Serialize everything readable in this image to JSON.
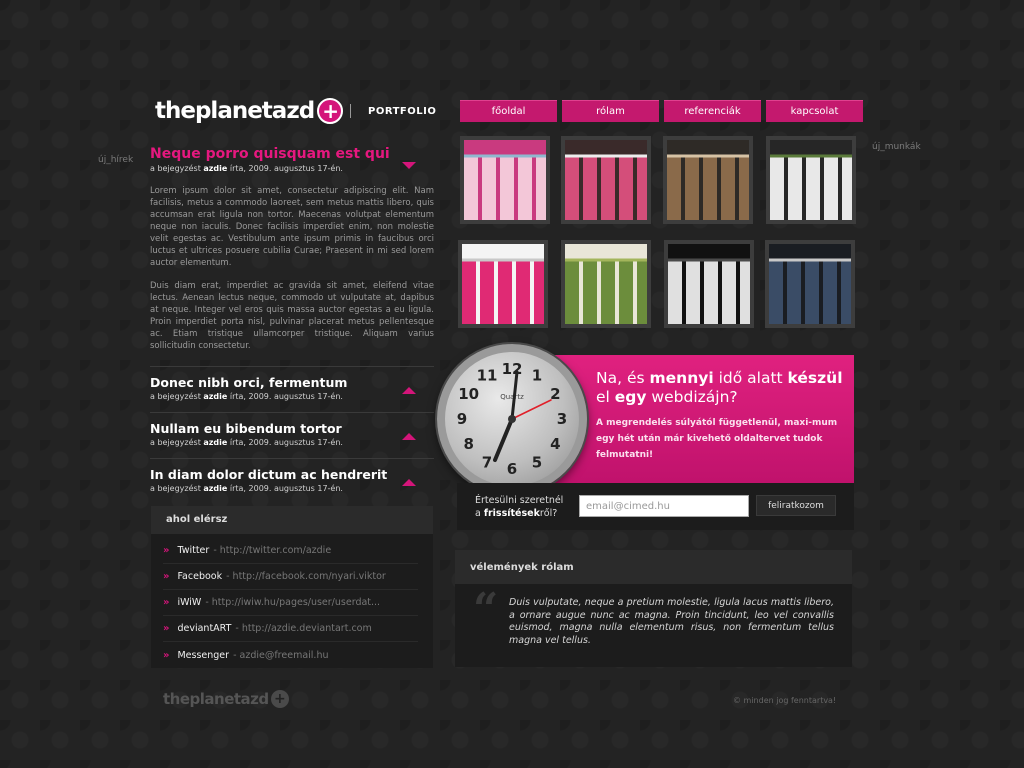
{
  "header": {
    "logo_text": "theplanetazd",
    "logo_plus": "+",
    "section": "PORTFOLIO"
  },
  "nav": [
    "főoldal",
    "rólam",
    "referenciák",
    "kapcsolat"
  ],
  "labels": {
    "news": "új_hírek",
    "works": "új_munkák"
  },
  "news": {
    "open": {
      "title": "Neque porro quisquam est qui",
      "meta_prefix": "a bejegyzést",
      "author": "azdie",
      "meta_suffix": "írta, 2009. augusztus 17-én.",
      "paragraphs": [
        "Lorem ipsum dolor sit amet, consectetur adipiscing elit. Nam facilisis, metus a commodo laoreet, sem metus mattis libero, quis accumsan erat ligula non tortor. Maecenas volutpat elementum neque non iaculis. Donec facilisis imperdiet enim, non molestie velit egestas ac. Vestibulum ante ipsum primis in faucibus orci luctus et ultrices posuere cubilia Curae; Praesent in mi sed lorem auctor elementum.",
        "Duis diam erat, imperdiet ac gravida sit amet, eleifend vitae lectus. Aenean lectus neque, commodo ut vulputate at, dapibus at neque. Integer vel eros quis massa auctor egestas a eu ligula. Proin imperdiet porta nisl, pulvinar placerat metus pellentesque ac. Etiam tristique ullamcorper tristique. Aliquam varius sollicitudin consectetur."
      ]
    },
    "collapsed": [
      {
        "title": "Donec nibh orci, fermentum",
        "meta_prefix": "a bejegyzést",
        "author": "azdie",
        "meta_suffix": "írta, 2009. augusztus 17-én."
      },
      {
        "title": "Nullam eu bibendum tortor",
        "meta_prefix": "a bejegyzést",
        "author": "azdie",
        "meta_suffix": "írta, 2009. augusztus 17-én."
      },
      {
        "title": "In diam dolor dictum ac hendrerit",
        "meta_prefix": "a bejegyzést",
        "author": "azdie",
        "meta_suffix": "írta, 2009. augusztus 17-én."
      }
    ]
  },
  "contact": {
    "title": "ahol elérsz",
    "items": [
      {
        "name": "Twitter",
        "url": "- http://twitter.com/azdie"
      },
      {
        "name": "Facebook",
        "url": "- http://facebook.com/nyari.viktor"
      },
      {
        "name": "iWiW",
        "url": "- http://iwiw.hu/pages/user/userdat..."
      },
      {
        "name": "deviantART",
        "url": "- http://azdie.deviantart.com"
      },
      {
        "name": "Messenger",
        "url": "- azdie@freemail.hu"
      }
    ]
  },
  "thumbnails": [
    {
      "colors": [
        "#c93a7f",
        "#f3c7d8",
        "#8fb9cf"
      ]
    },
    {
      "colors": [
        "#3a2a2a",
        "#d44e7a",
        "#ededed"
      ]
    },
    {
      "colors": [
        "#2e2a26",
        "#8a6a4a",
        "#d7c3a5"
      ]
    },
    {
      "colors": [
        "#262626",
        "#e8e8e8",
        "#5a7a3a"
      ]
    },
    {
      "colors": [
        "#f4f4f4",
        "#e02a74",
        "#c8c8c8"
      ]
    },
    {
      "colors": [
        "#e9e6d8",
        "#6c8d3c",
        "#a3b55b"
      ]
    },
    {
      "colors": [
        "#111111",
        "#e0e0e0",
        "#4a4a4a"
      ]
    },
    {
      "colors": [
        "#1a1d22",
        "#3a4c66",
        "#c8c8c8"
      ]
    }
  ],
  "promo": {
    "line1_a": "Na, és ",
    "line1_b": "mennyi",
    "line1_c": " idő alatt ",
    "line1_d": "készül",
    "line2_a": "el ",
    "line2_b": "egy",
    "line2_c": " webdizájn?",
    "sub": "A megrendelés súlyától függetlenül, maxi-mum egy hét után már kivehető oldaltervet tudok felmutatni!",
    "clock_brand": "Quartz",
    "clock_numbers": [
      "12",
      "1",
      "2",
      "3",
      "4",
      "5",
      "6",
      "7",
      "8",
      "9",
      "10",
      "11"
    ]
  },
  "notify": {
    "line1": "Értesülni szeretnél",
    "line2_a": "a ",
    "line2_b": "frissítések",
    "line2_c": "ről?",
    "placeholder": "email@cimed.hu",
    "button": "feliratkozom"
  },
  "opinions": {
    "title": "vélemények rólam",
    "quote_mark": "“",
    "quote": "Duis vulputate, neque a pretium molestie, ligula lacus mattis libero, a ornare augue nunc ac magna. Proin tincidunt, leo vel convallis euismod, magna nulla elementum risus, non fermentum tellus magna vel tellus."
  },
  "footer": {
    "logo_text": "theplanetazd",
    "logo_plus": "+",
    "copyright": "© minden jog fenntartva!"
  },
  "colors": {
    "accent": "#d4157a",
    "background": "#232323"
  }
}
